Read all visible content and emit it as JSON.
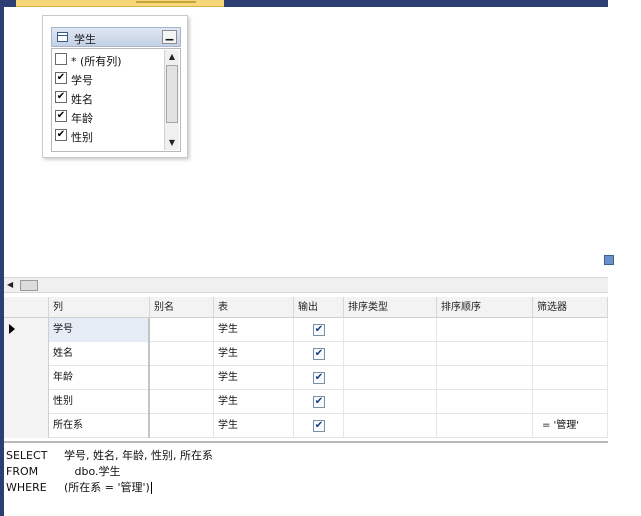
{
  "diagram": {
    "table": {
      "name": "学生",
      "minimize_glyph": "▁",
      "columns": [
        {
          "label": "* (所有列)",
          "checked": false
        },
        {
          "label": "学号",
          "checked": true
        },
        {
          "label": "姓名",
          "checked": true
        },
        {
          "label": "年龄",
          "checked": true
        },
        {
          "label": "性别",
          "checked": true
        }
      ]
    }
  },
  "grid": {
    "headers": [
      "列",
      "别名",
      "表",
      "输出",
      "排序类型",
      "排序顺序",
      "筛选器"
    ],
    "rows": [
      {
        "column": "学号",
        "alias": "",
        "table": "学生",
        "output": true,
        "sort_type": "",
        "sort_order": "",
        "filter": ""
      },
      {
        "column": "姓名",
        "alias": "",
        "table": "学生",
        "output": true,
        "sort_type": "",
        "sort_order": "",
        "filter": ""
      },
      {
        "column": "年龄",
        "alias": "",
        "table": "学生",
        "output": true,
        "sort_type": "",
        "sort_order": "",
        "filter": ""
      },
      {
        "column": "性别",
        "alias": "",
        "table": "学生",
        "output": true,
        "sort_type": "",
        "sort_order": "",
        "filter": ""
      },
      {
        "column": "所在系",
        "alias": "",
        "table": "学生",
        "output": true,
        "sort_type": "",
        "sort_order": "",
        "filter": "= '管理'"
      }
    ]
  },
  "sql": {
    "lines": [
      {
        "keyword": "SELECT",
        "text": "学号, 姓名, 年龄, 性别, 所在系"
      },
      {
        "keyword": "FROM",
        "text": "   dbo.学生"
      },
      {
        "keyword": "WHERE",
        "text": "(所在系 = '管理')"
      }
    ]
  },
  "glyphs": {
    "check": "✔",
    "up": "▲",
    "down": "▼",
    "left": "◀"
  },
  "colors": {
    "accent": "#2b3f75",
    "tab": "#f5d77a",
    "selected_cell": "#e7edf6"
  }
}
